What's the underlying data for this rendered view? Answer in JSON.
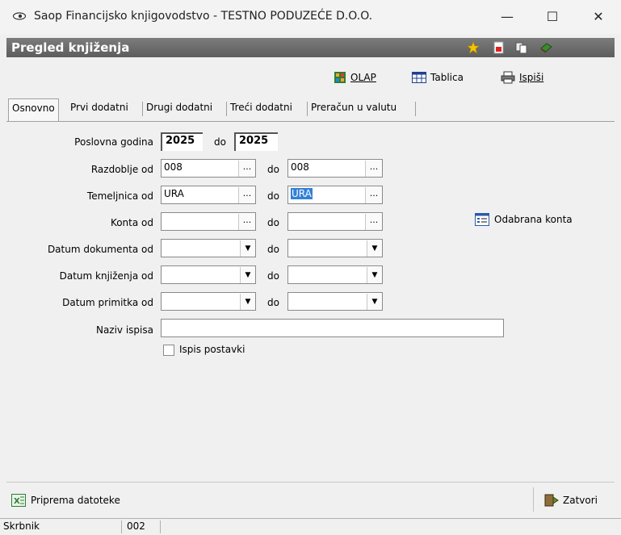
{
  "window": {
    "title": "Saop Financijsko knjigovodstvo - TESTNO PODUZEĆE D.O.O.",
    "minimize": "—",
    "maximize": "☐",
    "close": "✕"
  },
  "header": {
    "title": "Pregled knjiženja"
  },
  "toolbar": {
    "olap_label": "OLAP",
    "tablica_label": "Tablica",
    "ispisi_label": "Ispiši"
  },
  "tabs": [
    {
      "label": "Osnovno"
    },
    {
      "label": "Prvi dodatni"
    },
    {
      "label": "Drugi dodatni"
    },
    {
      "label": "Treći dodatni"
    },
    {
      "label": "Preračun u valutu"
    }
  ],
  "form": {
    "poslovna_godina": {
      "label": "Poslovna godina",
      "from": "2025",
      "do": "do",
      "to": "2025"
    },
    "razdoblje": {
      "label": "Razdoblje od",
      "from": "008",
      "do": "do",
      "to": "008"
    },
    "temeljnica": {
      "label": "Temeljnica od",
      "from": "URA",
      "do": "do",
      "to": "URA"
    },
    "konta": {
      "label": "Konta od",
      "from": "",
      "do": "do",
      "to": ""
    },
    "datum_dokumenta": {
      "label": "Datum dokumenta od",
      "from": "",
      "do": "do",
      "to": ""
    },
    "datum_knjizenja": {
      "label": "Datum knjiženja od",
      "from": "",
      "do": "do",
      "to": ""
    },
    "datum_primitka": {
      "label": "Datum primitka od",
      "from": "",
      "do": "do",
      "to": ""
    },
    "naziv_ispisa": {
      "label": "Naziv ispisa",
      "value": ""
    },
    "ispis_postavki": {
      "label": "Ispis postavki",
      "checked": false
    },
    "odabrana_konta": {
      "label": "Odabrana konta"
    },
    "ellipsis": "...",
    "dropdown": "▼"
  },
  "bottom": {
    "priprema_label": "Priprema datoteke",
    "zatvori_label": "Zatvori"
  },
  "status": {
    "user": "Skrbnik",
    "code": "002"
  },
  "colors": {
    "header_bg": "#6b6b6b",
    "selection": "#3380d8"
  }
}
